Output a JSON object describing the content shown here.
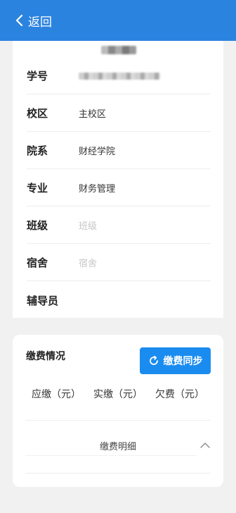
{
  "header": {
    "back_label": "返回",
    "bg_color": "#2b83e0"
  },
  "profile": {
    "name": "",
    "rows": [
      {
        "label": "学号",
        "value": ""
      },
      {
        "label": "校区",
        "value": "主校区"
      },
      {
        "label": "院系",
        "value": "财经学院"
      },
      {
        "label": "专业",
        "value": "财务管理"
      },
      {
        "label": "班级",
        "value": "班级"
      },
      {
        "label": "宿舍",
        "value": "宿舍"
      },
      {
        "label": "辅导员",
        "value": ""
      }
    ]
  },
  "payment": {
    "title": "缴费情况",
    "sync_label": "缴费同步",
    "sync_color": "#1a8cf0",
    "columns": [
      "应缴（元）",
      "实缴（元）",
      "欠费（元）"
    ],
    "detail_label": "缴费明细"
  }
}
